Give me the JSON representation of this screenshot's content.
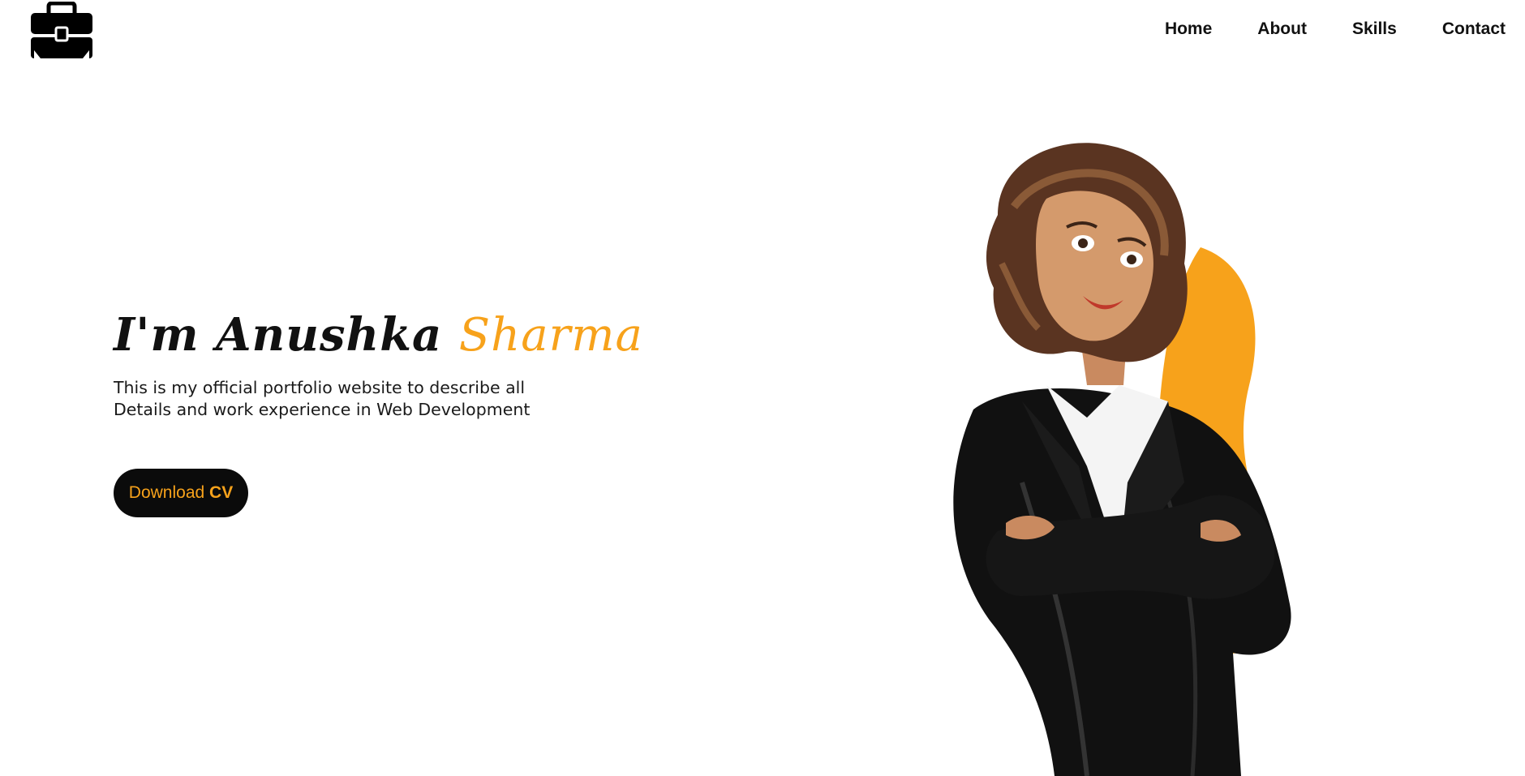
{
  "nav": {
    "items": [
      "Home",
      "About",
      "Skills",
      "Contact"
    ]
  },
  "hero": {
    "title_prefix": "I'm Anushka",
    "title_accent": "Sharma",
    "description_line1": "This is my official portfolio website to describe all",
    "description_line2": "Details and work experience in Web Development",
    "cv_button_prefix": "Download",
    "cv_button_strong": "CV"
  },
  "icons": {
    "logo": "briefcase-icon"
  },
  "colors": {
    "accent": "#f7a21b",
    "text": "#111111",
    "background": "#ffffff",
    "button_bg": "#0b0b0b"
  }
}
